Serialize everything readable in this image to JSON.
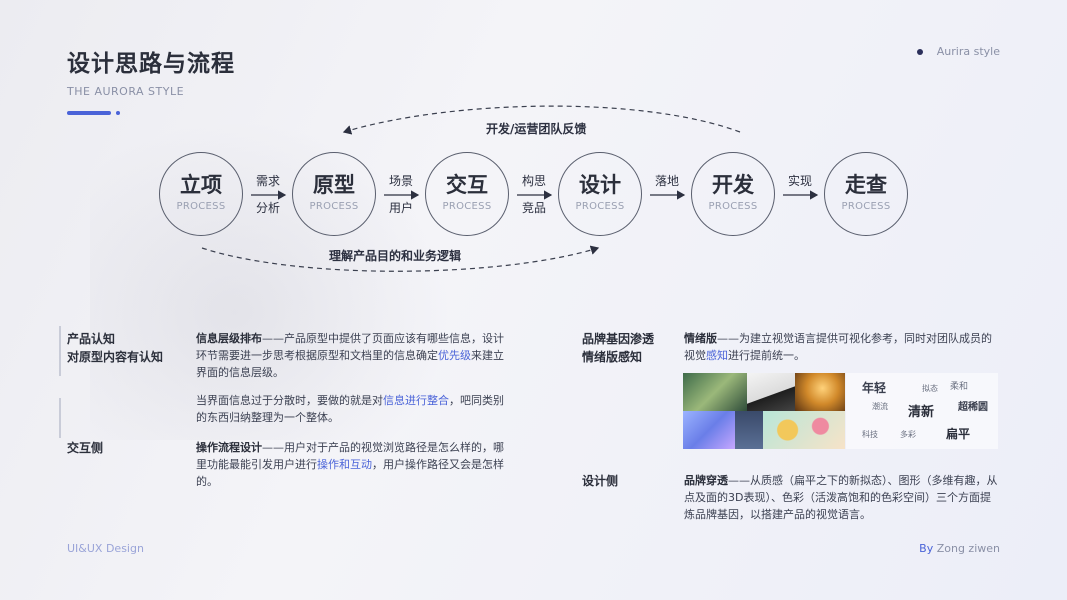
{
  "header": {
    "title": "设计思路与流程",
    "subtitle": "THE AURORA STYLE",
    "brand": "Aurira style"
  },
  "process": {
    "nodes": [
      {
        "label": "立项",
        "sub": "PROCESS"
      },
      {
        "label": "原型",
        "sub": "PROCESS"
      },
      {
        "label": "交互",
        "sub": "PROCESS"
      },
      {
        "label": "设计",
        "sub": "PROCESS"
      },
      {
        "label": "开发",
        "sub": "PROCESS"
      },
      {
        "label": "走查",
        "sub": "PROCESS"
      }
    ],
    "connectors": [
      {
        "top": "需求",
        "bottom": "分析"
      },
      {
        "top": "场景",
        "bottom": "用户"
      },
      {
        "top": "构思",
        "bottom": "竞品"
      },
      {
        "top": "落地",
        "bottom": ""
      },
      {
        "top": "实现",
        "bottom": ""
      }
    ],
    "feedback_label": "开发/运营团队反馈",
    "understanding_label": "理解产品目的和业务逻辑"
  },
  "left": {
    "heading1_line1": "产品认知",
    "heading1_line2": "对原型内容有认知",
    "heading2": "交互侧",
    "p1_bold": "信息层级排布",
    "p1_text_a": "——产品原型中提供了页面应该有哪些信息，设计环节需要进一步思考根据原型和文档里的信息确定",
    "p1_highlight": "优先级",
    "p1_text_b": "来建立界面的信息层级。",
    "p2_text_a": "当界面信息过于分散时，要做的就是对",
    "p2_highlight": "信息进行整合",
    "p2_text_b": "，吧同类别的东西归纳整理为一个整体。",
    "p3_bold": "操作流程设计",
    "p3_text_a": "——用户对于产品的视觉浏览路径是怎么样的，哪里功能最能引发用户进行",
    "p3_highlight": "操作和互动",
    "p3_text_b": "，用户操作路径又会是怎样的。"
  },
  "right": {
    "heading1_line1": "品牌基因渗透",
    "heading1_line2": "情绪版感知",
    "heading2": "设计侧",
    "p1_bold": "情绪版",
    "p1_text_a": "——为建立视觉语言提供可视化参考，同时对团队成员的视觉",
    "p1_highlight": "感知",
    "p1_text_b": "进行提前统一。",
    "p2_bold": "品牌穿透",
    "p2_text": "——从质感（扁平之下的新拟态）、图形（多维有趣，从点及面的3D表现）、色彩（活泼高饱和的色彩空间）三个方面提炼品牌基因，以搭建产品的视觉语言。",
    "wordcloud": [
      "年轻",
      "拟态",
      "柔和",
      "潮流",
      "清新",
      "超稀圆",
      "科技",
      "多彩",
      "扁平"
    ]
  },
  "footer": {
    "left": "UI&UX  Design",
    "right_by": "By",
    "right_name": " Zong ziwen"
  },
  "colors": {
    "accent": "#4a63d8",
    "title": "#2b2f3b"
  }
}
